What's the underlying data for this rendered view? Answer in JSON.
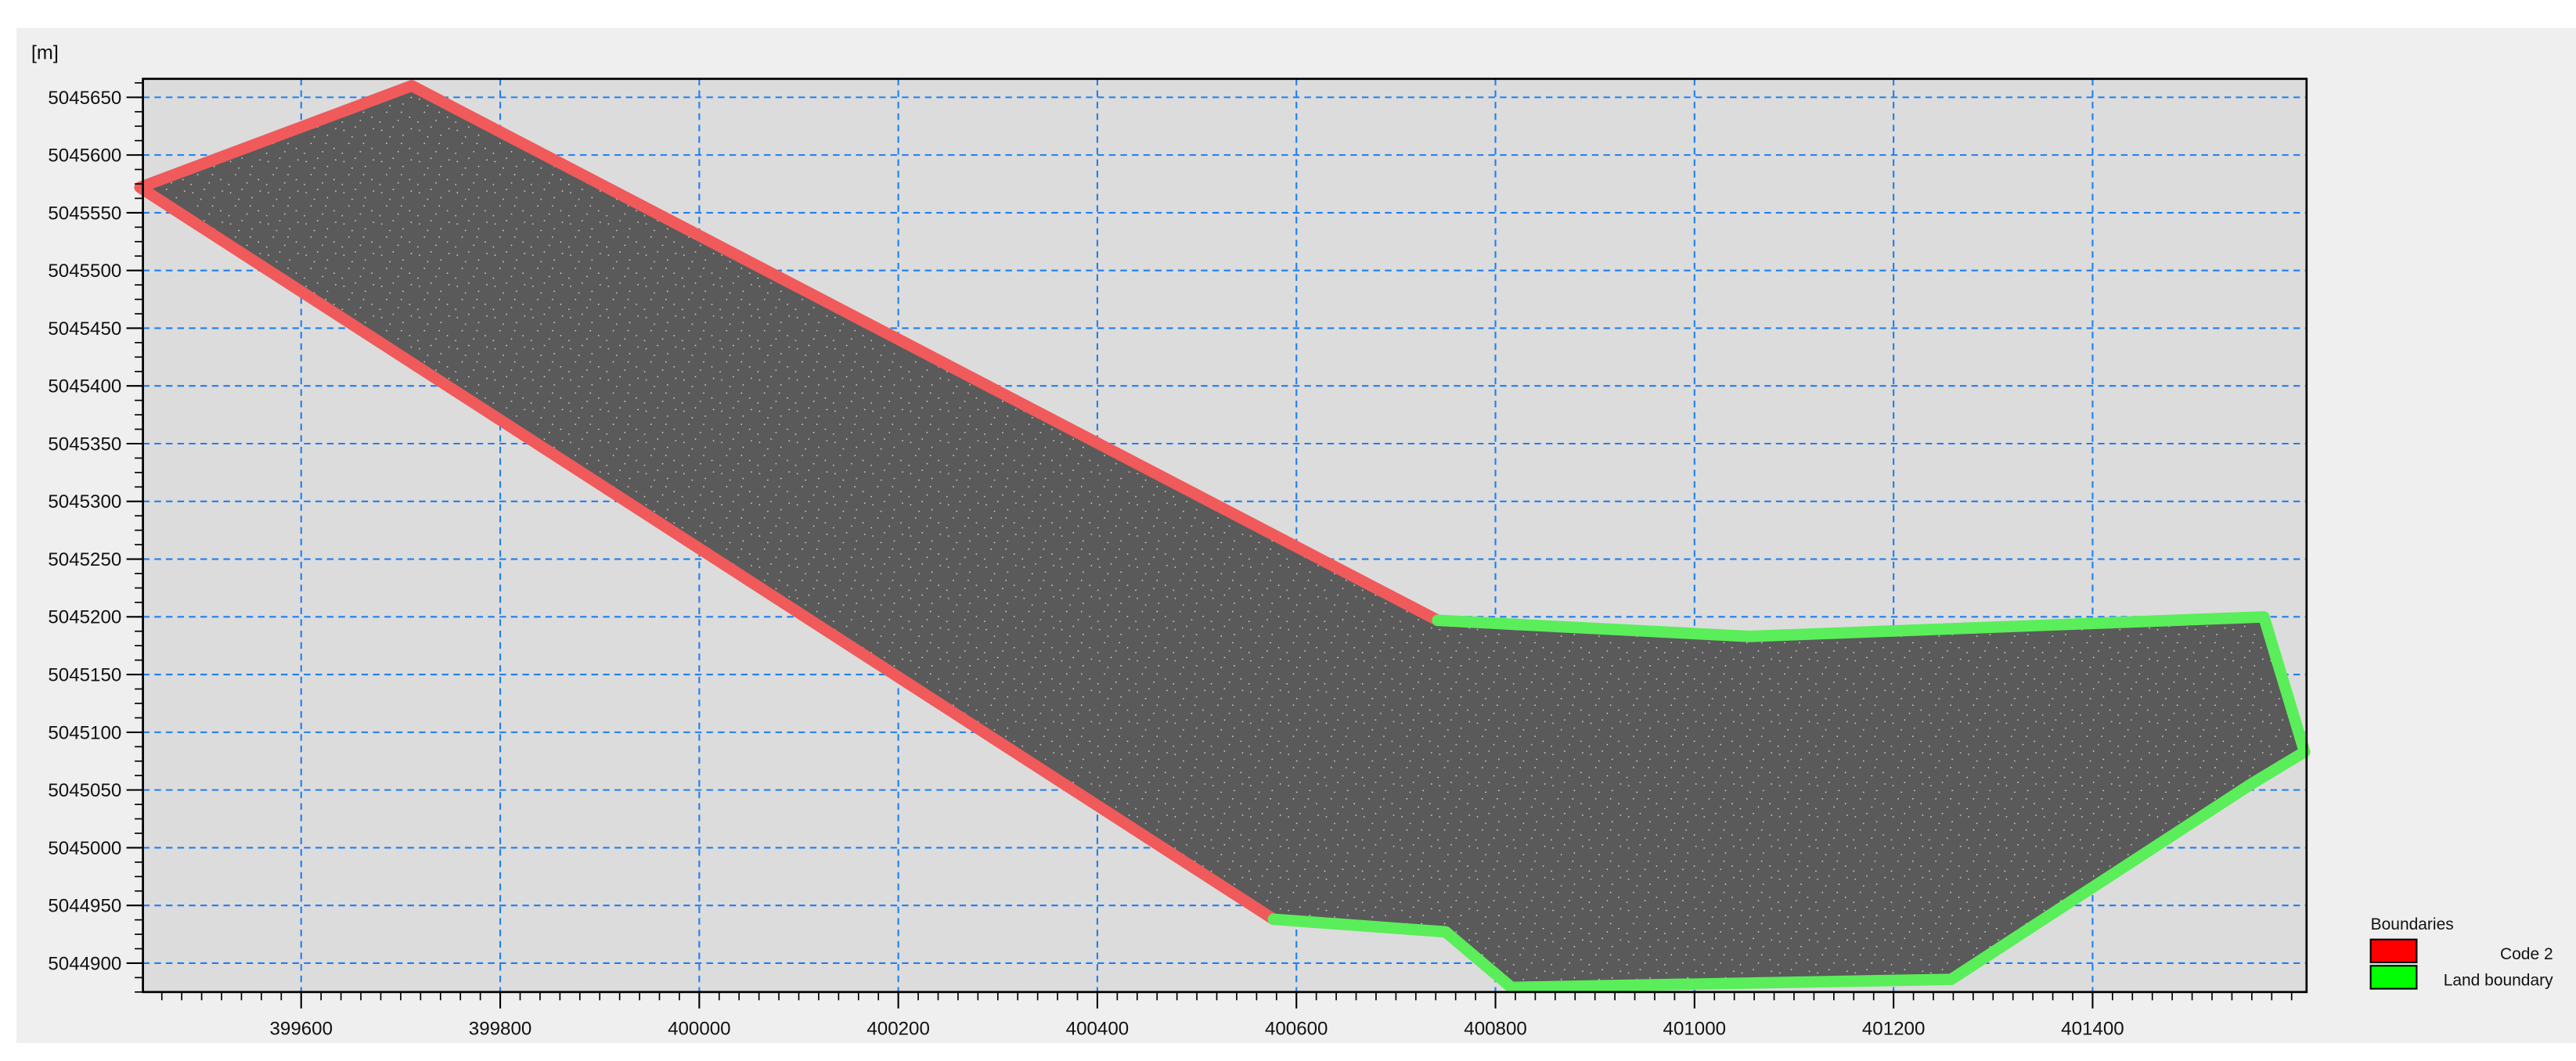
{
  "chart_data": {
    "type": "line",
    "title": "",
    "unit_label": "[m]",
    "xlabel": "",
    "ylabel": "",
    "xlim": [
      399441,
      401615
    ],
    "ylim": [
      5044875,
      5045666
    ],
    "x_ticks": [
      399600,
      399800,
      400000,
      400200,
      400400,
      400600,
      400800,
      401000,
      401200,
      401400
    ],
    "y_ticks": [
      5045650,
      5045600,
      5045550,
      5045500,
      5045450,
      5045400,
      5045350,
      5045300,
      5045250,
      5045200,
      5045150,
      5045100,
      5045050,
      5045000,
      5044950,
      5044900
    ],
    "x_minor_step": 20,
    "y_minor_step": 12.5,
    "grid": true,
    "grid_color": "#1e7ff0",
    "plot_background": "#dcdcdc",
    "mesh_fill": "#5a5a5a",
    "mesh_polygon": [
      [
        399438,
        5045572
      ],
      [
        399711,
        5045660
      ],
      [
        400742,
        5045197
      ],
      [
        401055,
        5045183
      ],
      [
        401572,
        5045200
      ],
      [
        401613,
        5045083
      ],
      [
        401559,
        5045055
      ],
      [
        401258,
        5044886
      ],
      [
        400816,
        5044879
      ],
      [
        400750,
        5044927
      ],
      [
        400577,
        5044938
      ]
    ],
    "legend": {
      "title": "Boundaries",
      "placement": "bottom-right outside",
      "entries": [
        {
          "name": "Code 2",
          "color": "#ff0000"
        },
        {
          "name": "Land boundary",
          "color": "#00ff00"
        }
      ]
    },
    "series": [
      {
        "name": "Code 2",
        "color": "#f05a5a",
        "segments": [
          [
            [
              400742,
              5045197
            ],
            [
              399711,
              5045660
            ],
            [
              399438,
              5045572
            ],
            [
              400577,
              5044938
            ]
          ]
        ]
      },
      {
        "name": "Land boundary",
        "color": "#5aee5a",
        "segments": [
          [
            [
              400742,
              5045197
            ],
            [
              401055,
              5045183
            ],
            [
              401572,
              5045200
            ],
            [
              401613,
              5045083
            ],
            [
              401559,
              5045055
            ],
            [
              401258,
              5044886
            ],
            [
              400816,
              5044879
            ],
            [
              400750,
              5044927
            ],
            [
              400577,
              5044938
            ]
          ]
        ]
      }
    ]
  }
}
